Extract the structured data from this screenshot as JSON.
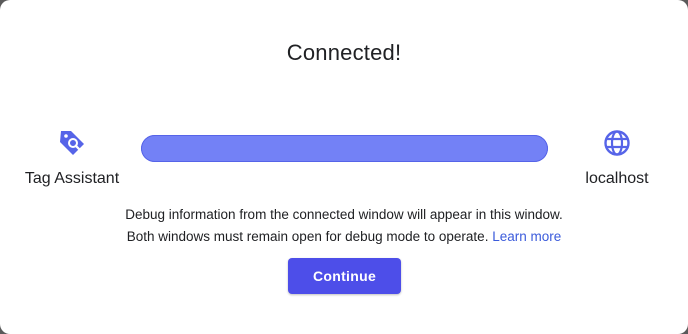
{
  "dialog": {
    "title": "Connected!",
    "source": {
      "label": "Tag Assistant",
      "icon": "tag-assistant-icon"
    },
    "target": {
      "label": "localhost",
      "icon": "globe-icon"
    },
    "progress": {
      "value": 1.0
    },
    "info_line1": "Debug information from the connected window will appear in this window.",
    "info_line2": "Both windows must remain open for debug mode to operate.",
    "learn_more": "Learn more",
    "continue_label": "Continue"
  },
  "colors": {
    "accent": "#4d4ee9",
    "progress_fill": "#7381f6",
    "icon": "#5664e8",
    "link": "#3b5bdb"
  }
}
